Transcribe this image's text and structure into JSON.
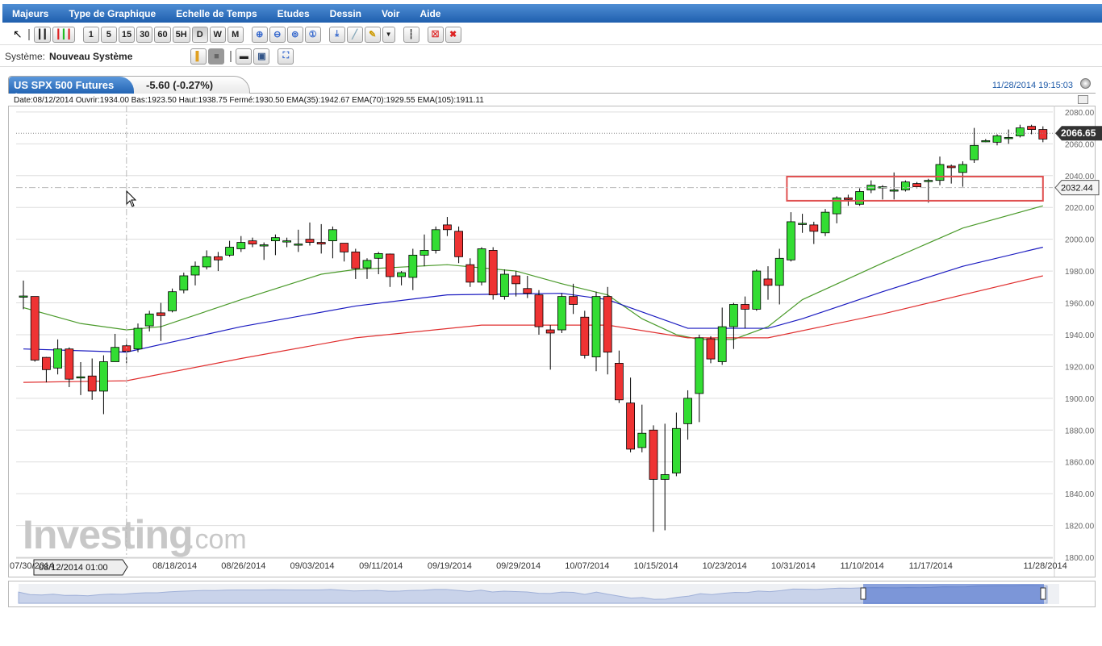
{
  "menu": [
    "Majeurs",
    "Type de Graphique",
    "Echelle de Temps",
    "Etudes",
    "Dessin",
    "Voir",
    "Aide"
  ],
  "toolbar": {
    "periods": [
      "1",
      "5",
      "15",
      "30",
      "60",
      "5H",
      "D",
      "W",
      "M"
    ],
    "active_period": "D"
  },
  "system": {
    "label": "Système:",
    "value": "Nouveau Système"
  },
  "instrument": {
    "name": "US SPX 500 Futures (...",
    "change": "-5.60 (-0.27%)",
    "timestamp": "11/28/2014 19:15:03"
  },
  "info_line": "Date:08/12/2014 Ouvrir:1934.00 Bas:1923.50 Haut:1938.75 Fermé:1930.50 EMA(35):1942.67 EMA(70):1929.55 EMA(105):1911.11",
  "crosshair": {
    "date_label": "08/12/2014 01:00",
    "price_label": "2032.44",
    "price": 2032.44,
    "candle_index": 9
  },
  "last_price": {
    "label": "2066.65",
    "value": 2066.65
  },
  "watermark": "Investing.com",
  "colors": {
    "up": "#33dd33",
    "down": "#ee3333",
    "ema35": "#4a9a2a",
    "ema70": "#1a1ac0",
    "ema105": "#e03030",
    "menu": "#2a6bbf",
    "box": "#e05050"
  },
  "chart_data": {
    "type": "candlestick",
    "ylim": [
      1800,
      2084
    ],
    "yticks": [
      "1800.00",
      "1820.00",
      "1840.00",
      "1860.00",
      "1880.00",
      "1900.00",
      "1920.00",
      "1940.00",
      "1960.00",
      "1980.00",
      "2000.00",
      "2020.00",
      "2040.00",
      "2060.00",
      "2080.00"
    ],
    "xticks": [
      {
        "i": 0,
        "label": "07/30/2014"
      },
      {
        "i": 13,
        "label": "08/18/2014"
      },
      {
        "i": 19,
        "label": "08/26/2014"
      },
      {
        "i": 25,
        "label": "09/03/2014"
      },
      {
        "i": 31,
        "label": "09/11/2014"
      },
      {
        "i": 37,
        "label": "09/19/2014"
      },
      {
        "i": 43,
        "label": "09/29/2014"
      },
      {
        "i": 49,
        "label": "10/07/2014"
      },
      {
        "i": 55,
        "label": "10/15/2014"
      },
      {
        "i": 61,
        "label": "10/23/2014"
      },
      {
        "i": 67,
        "label": "10/31/2014"
      },
      {
        "i": 73,
        "label": "11/10/2014"
      },
      {
        "i": 79,
        "label": "11/17/2014"
      },
      {
        "i": 89,
        "label": "11/28/2014"
      }
    ],
    "ohlc": [
      [
        1964,
        1974,
        1956,
        1964.3
      ],
      [
        1964,
        1964,
        1923,
        1924
      ],
      [
        1925.7,
        1926,
        1910,
        1918
      ],
      [
        1919,
        1937,
        1915,
        1931
      ],
      [
        1931,
        1932,
        1907,
        1912
      ],
      [
        1913.5,
        1922.7,
        1902,
        1913.5
      ],
      [
        1914,
        1925,
        1899,
        1904.5
      ],
      [
        1904.5,
        1927,
        1890,
        1923
      ],
      [
        1923,
        1940.5,
        1923,
        1932
      ],
      [
        1933,
        1937,
        1922,
        1929.5
      ],
      [
        1931,
        1947,
        1929,
        1944
      ],
      [
        1945.5,
        1955,
        1942,
        1953
      ],
      [
        1953.7,
        1960,
        1936,
        1952
      ],
      [
        1955,
        1969,
        1954,
        1967
      ],
      [
        1968,
        1979,
        1966,
        1977
      ],
      [
        1977.5,
        1986,
        1971,
        1983
      ],
      [
        1982.6,
        1993,
        1981,
        1989
      ],
      [
        1989,
        1992,
        1980,
        1987
      ],
      [
        1990,
        1999,
        1989,
        1995
      ],
      [
        1994,
        2002,
        1992,
        1998
      ],
      [
        1999,
        2001,
        1995,
        1997
      ],
      [
        1996.5,
        1998,
        1987,
        1996.5
      ],
      [
        1999,
        2003,
        1990,
        2001
      ],
      [
        1999,
        2001,
        1995,
        1999
      ],
      [
        1997,
        2006,
        1992,
        1997
      ],
      [
        2000,
        2010.5,
        1996,
        1998
      ],
      [
        1998,
        2009.5,
        1991,
        1997
      ],
      [
        1999,
        2008,
        1988,
        2006
      ],
      [
        1997.5,
        1997.5,
        1986,
        1992
      ],
      [
        1992,
        1994,
        1975,
        1981.6
      ],
      [
        1982,
        1988,
        1975,
        1986.7
      ],
      [
        1988,
        1992,
        1978,
        1991
      ],
      [
        1990.7,
        1991,
        1970,
        1976.5
      ],
      [
        1976.5,
        1980,
        1971,
        1979
      ],
      [
        1976,
        1994,
        1968,
        1990
      ],
      [
        1990,
        2003,
        1983,
        1993
      ],
      [
        1993,
        2008,
        1991,
        2006
      ],
      [
        2009,
        2014,
        2002,
        2006
      ],
      [
        2005,
        2008,
        1985,
        1989
      ],
      [
        1984,
        1988,
        1970,
        1973
      ],
      [
        1973,
        1995,
        1971,
        1994
      ],
      [
        1993,
        1995,
        1962,
        1965
      ],
      [
        1964,
        1981,
        1962,
        1978
      ],
      [
        1977,
        1980,
        1964,
        1972
      ],
      [
        1969,
        1977,
        1963,
        1966
      ],
      [
        1965,
        1968,
        1940,
        1945
      ],
      [
        1943,
        1946,
        1918,
        1941
      ],
      [
        1943,
        1966,
        1941,
        1964
      ],
      [
        1964,
        1972,
        1953,
        1959
      ],
      [
        1951,
        1955,
        1925,
        1927
      ],
      [
        1926,
        1967,
        1917,
        1964
      ],
      [
        1964,
        1970,
        1915,
        1929
      ],
      [
        1922,
        1930,
        1897,
        1899
      ],
      [
        1897,
        1913,
        1866,
        1868
      ],
      [
        1869,
        1896,
        1866,
        1878
      ],
      [
        1880,
        1883,
        1816,
        1849
      ],
      [
        1849,
        1884,
        1817,
        1852
      ],
      [
        1853,
        1891,
        1851,
        1881
      ],
      [
        1884,
        1905,
        1874,
        1900
      ],
      [
        1903,
        1940,
        1885,
        1938
      ],
      [
        1937.4,
        1939,
        1922,
        1924.7
      ],
      [
        1923,
        1957,
        1921,
        1945
      ],
      [
        1945,
        1960,
        1931,
        1959
      ],
      [
        1959,
        1964,
        1944,
        1956
      ],
      [
        1956,
        1981,
        1955,
        1980
      ],
      [
        1975,
        1983,
        1962,
        1971
      ],
      [
        1971,
        1994,
        1959,
        1988
      ],
      [
        1987,
        2017,
        1986,
        2011
      ],
      [
        2010,
        2016,
        2004,
        2010
      ],
      [
        2009,
        2011,
        1997,
        2005
      ],
      [
        2004,
        2019,
        2002,
        2017
      ],
      [
        2016,
        2027,
        2010,
        2026
      ],
      [
        2026,
        2028,
        2021,
        2025
      ],
      [
        2022,
        2032,
        2021,
        2030
      ],
      [
        2031,
        2037,
        2029,
        2034
      ],
      [
        2033,
        2034,
        2025,
        2033
      ],
      [
        2031,
        2042,
        2025,
        2031
      ],
      [
        2031,
        2037,
        2030,
        2036
      ],
      [
        2035,
        2036,
        2032,
        2033
      ],
      [
        2037,
        2038,
        2023,
        2037
      ],
      [
        2037,
        2052,
        2034,
        2047
      ],
      [
        2046,
        2047,
        2035,
        2045
      ],
      [
        2042,
        2049,
        2033,
        2047
      ],
      [
        2050,
        2070,
        2048,
        2059
      ],
      [
        2062,
        2063,
        2061,
        2062
      ],
      [
        2061,
        2066,
        2059,
        2065
      ],
      [
        2064,
        2069,
        2060,
        2064
      ],
      [
        2065,
        2072,
        2064,
        2070
      ],
      [
        2071,
        2072,
        2066,
        2069
      ],
      [
        2069,
        2071,
        2061,
        2063
      ]
    ],
    "ema35": [
      [
        0,
        1957
      ],
      [
        5,
        1947
      ],
      [
        9,
        1943
      ],
      [
        12,
        1945
      ],
      [
        19,
        1962
      ],
      [
        26,
        1978
      ],
      [
        29,
        1981
      ],
      [
        37,
        1984
      ],
      [
        43,
        1980
      ],
      [
        47,
        1972
      ],
      [
        51,
        1965
      ],
      [
        54,
        1950
      ],
      [
        57,
        1940
      ],
      [
        59,
        1937
      ],
      [
        62,
        1937
      ],
      [
        65,
        1945
      ],
      [
        68,
        1962
      ],
      [
        75,
        1985
      ],
      [
        82,
        2007
      ],
      [
        89,
        2021
      ]
    ],
    "ema70": [
      [
        0,
        1931
      ],
      [
        9,
        1929
      ],
      [
        19,
        1945
      ],
      [
        29,
        1958
      ],
      [
        37,
        1965
      ],
      [
        47,
        1966
      ],
      [
        51,
        1962
      ],
      [
        58,
        1944
      ],
      [
        65,
        1944
      ],
      [
        68,
        1950
      ],
      [
        75,
        1967
      ],
      [
        82,
        1983
      ],
      [
        89,
        1995
      ]
    ],
    "ema105": [
      [
        0,
        1910
      ],
      [
        9,
        1911
      ],
      [
        19,
        1925
      ],
      [
        29,
        1938
      ],
      [
        40,
        1946
      ],
      [
        51,
        1946
      ],
      [
        58,
        1938
      ],
      [
        65,
        1938
      ],
      [
        75,
        1953
      ],
      [
        89,
        1977
      ]
    ],
    "box": {
      "from": 67,
      "to": 89,
      "top": 2039.4,
      "bottom": 2024.2
    }
  }
}
